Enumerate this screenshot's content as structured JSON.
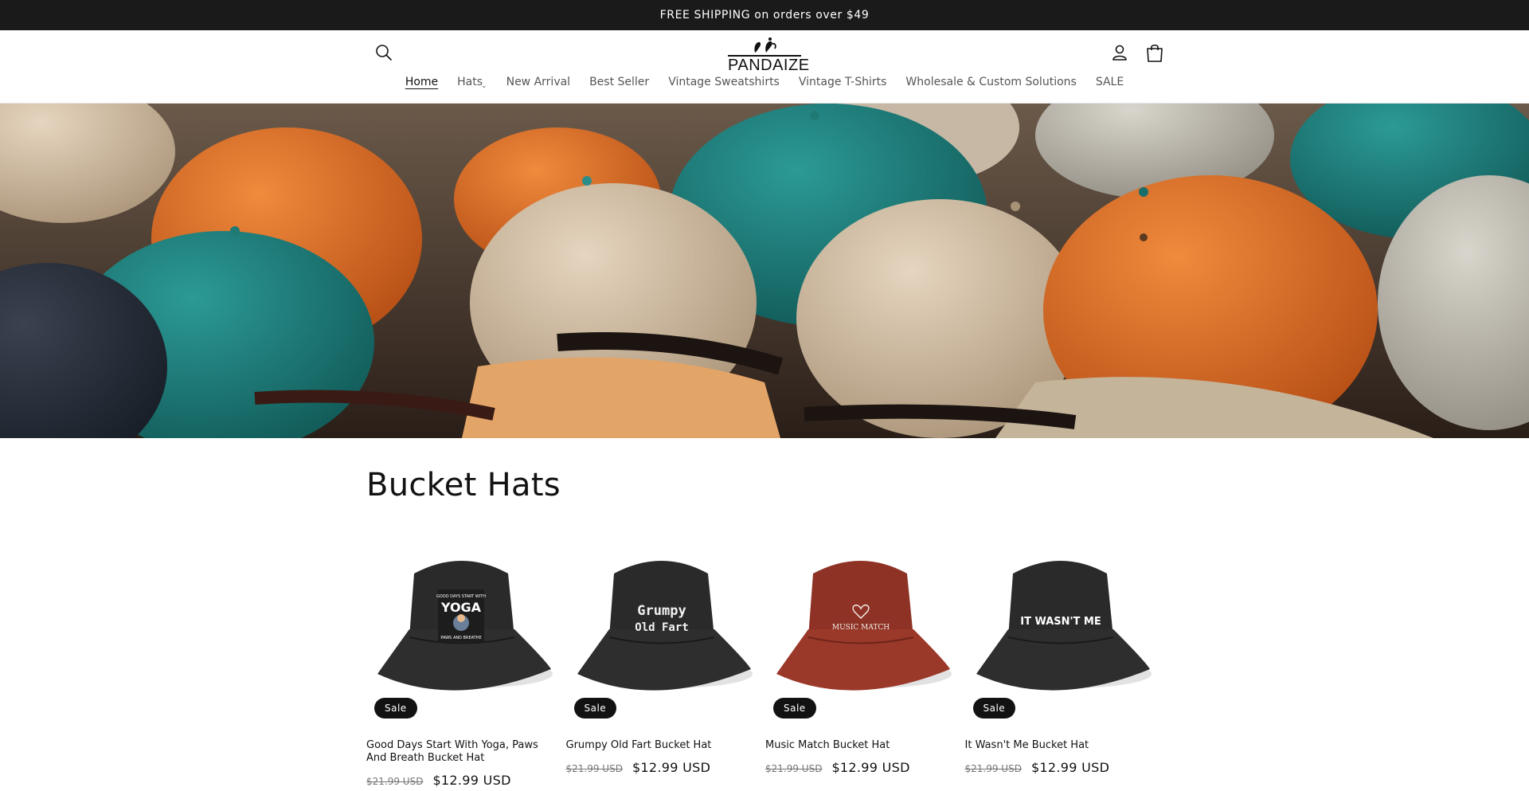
{
  "announcement": {
    "text": "FREE SHIPPING on orders over $49"
  },
  "header": {
    "logo_text": "PANDAIZE",
    "icons": {
      "search": "search-icon",
      "account": "account-icon",
      "cart": "cart-icon"
    }
  },
  "nav": {
    "items": [
      {
        "label": "Home",
        "active": true
      },
      {
        "label": "Hats",
        "has_dropdown": true
      },
      {
        "label": "New Arrival"
      },
      {
        "label": "Best Seller"
      },
      {
        "label": "Vintage Sweatshirts"
      },
      {
        "label": "Vintage T-Shirts"
      },
      {
        "label": "Wholesale & Custom Solutions"
      },
      {
        "label": "SALE"
      }
    ]
  },
  "collection": {
    "title": "Bucket Hats"
  },
  "products": [
    {
      "title": "Good Days Start With Yoga, Paws And Breath Bucket Hat",
      "badge": "Sale",
      "compare_price": "$21.99 USD",
      "price": "$12.99 USD",
      "hat_color": "#2a2a2a",
      "print": "YOGA",
      "print_top": "GOOD DAYS START WITH",
      "print_bottom": "PAWS AND BREATHE"
    },
    {
      "title": "Grumpy Old Fart Bucket Hat",
      "badge": "Sale",
      "compare_price": "$21.99 USD",
      "price": "$12.99 USD",
      "hat_color": "#2a2a2a",
      "print": "Grumpy",
      "print_sub": "Old Fart"
    },
    {
      "title": "Music Match Bucket Hat",
      "badge": "Sale",
      "compare_price": "$21.99 USD",
      "price": "$12.99 USD",
      "hat_color": "#8f3226",
      "print": "MUSIC MATCH"
    },
    {
      "title": "It Wasn't Me Bucket Hat",
      "badge": "Sale",
      "compare_price": "$21.99 USD",
      "price": "$12.99 USD",
      "hat_color": "#2a2a2a",
      "print": "IT WASN'T ME"
    }
  ]
}
